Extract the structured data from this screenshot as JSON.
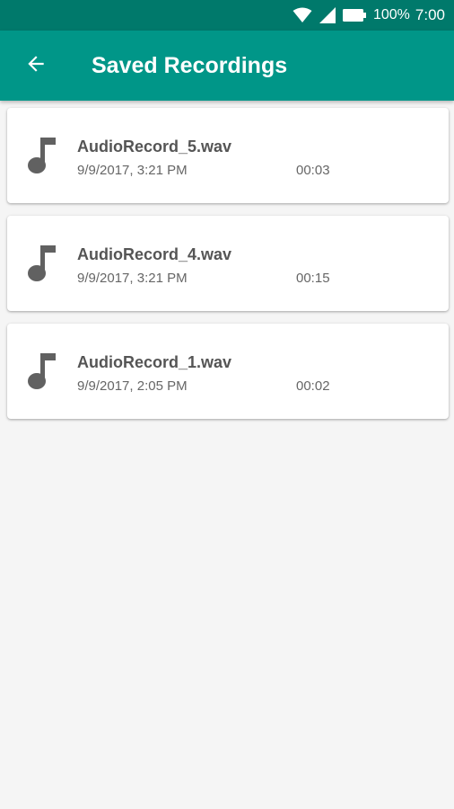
{
  "status_bar": {
    "battery_text": "100%",
    "time": "7:00",
    "icons": [
      "wifi-icon",
      "signal-icon",
      "battery-icon"
    ]
  },
  "app_bar": {
    "title": "Saved Recordings",
    "back_icon": "arrow-back-icon"
  },
  "recordings": [
    {
      "name": "AudioRecord_5.wav",
      "date": "9/9/2017, 3:21 PM",
      "duration": "00:03",
      "icon": "music-note-icon"
    },
    {
      "name": "AudioRecord_4.wav",
      "date": "9/9/2017, 3:21 PM",
      "duration": "00:15",
      "icon": "music-note-icon"
    },
    {
      "name": "AudioRecord_1.wav",
      "date": "9/9/2017, 2:05 PM",
      "duration": "00:02",
      "icon": "music-note-icon"
    }
  ],
  "colors": {
    "status_bar": "#00796b",
    "app_bar": "#009688",
    "background": "#f5f5f5",
    "card": "#ffffff",
    "icon_gray": "#616161"
  }
}
